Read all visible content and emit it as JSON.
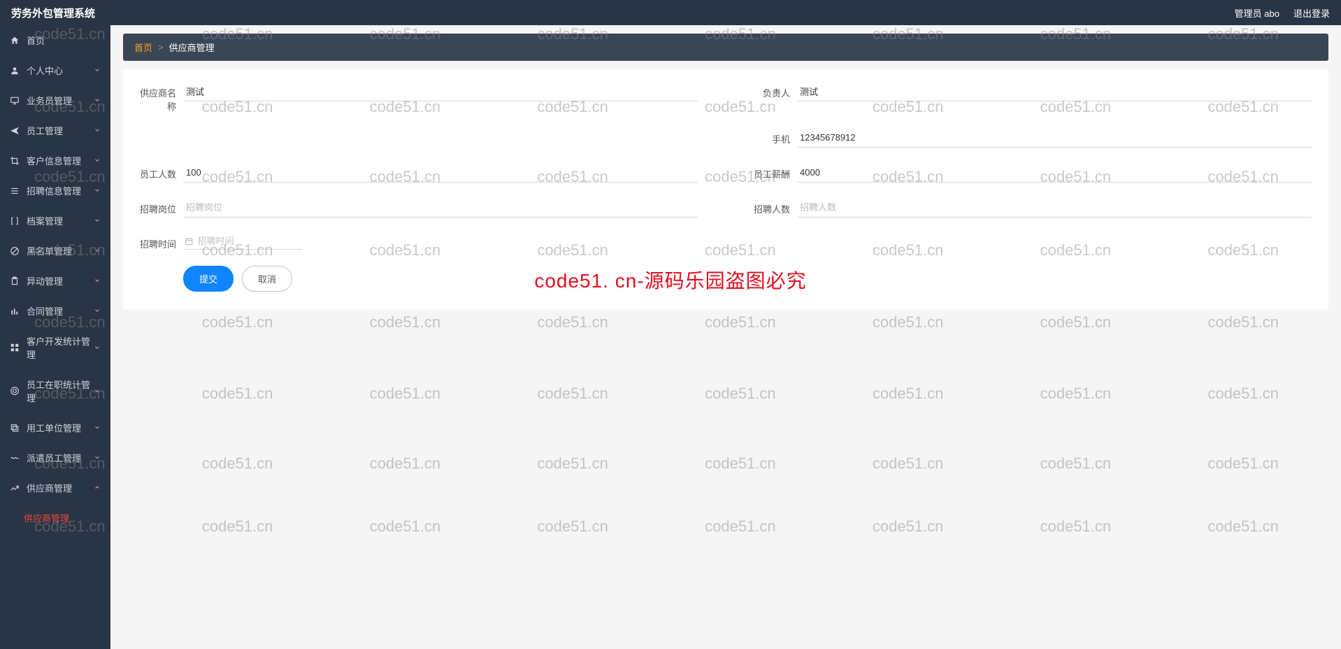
{
  "header": {
    "title": "劳务外包管理系统",
    "user_label": "管理员 abo",
    "logout_label": "退出登录"
  },
  "sidebar": {
    "items": [
      {
        "icon": "home",
        "label": "首页",
        "chevron": false
      },
      {
        "icon": "user",
        "label": "个人中心",
        "chevron": true
      },
      {
        "icon": "monitor",
        "label": "业务员管理",
        "chevron": true
      },
      {
        "icon": "send",
        "label": "员工管理",
        "chevron": true
      },
      {
        "icon": "crop",
        "label": "客户信息管理",
        "chevron": true
      },
      {
        "icon": "list",
        "label": "招聘信息管理",
        "chevron": true
      },
      {
        "icon": "bracket",
        "label": "档案管理",
        "chevron": true
      },
      {
        "icon": "slash",
        "label": "黑名单管理",
        "chevron": true
      },
      {
        "icon": "clipboard",
        "label": "异动管理",
        "chevron": true
      },
      {
        "icon": "bar",
        "label": "合同管理",
        "chevron": true
      },
      {
        "icon": "grid",
        "label": "客户开发统计管理",
        "chevron": true
      },
      {
        "icon": "target",
        "label": "员工在职统计管理",
        "chevron": true
      },
      {
        "icon": "copy",
        "label": "用工单位管理",
        "chevron": true
      },
      {
        "icon": "wave",
        "label": "派遣员工管理",
        "chevron": true
      },
      {
        "icon": "graph",
        "label": "供应商管理",
        "chevron": true,
        "expanded": true
      }
    ],
    "subitem_label": "供应商管理"
  },
  "breadcrumb": {
    "home": "首页",
    "sep": ">",
    "current": "供应商管理"
  },
  "form": {
    "supplier_name": {
      "label": "供应商名称",
      "value": "测试"
    },
    "manager": {
      "label": "负责人",
      "value": "测试"
    },
    "phone": {
      "label": "手机",
      "value": "12345678912"
    },
    "emp_count": {
      "label": "员工人数",
      "value": "100"
    },
    "emp_salary": {
      "label": "员工薪酬",
      "value": "4000"
    },
    "job_post": {
      "label": "招聘岗位",
      "placeholder": "招聘岗位",
      "value": ""
    },
    "hire_count": {
      "label": "招聘人数",
      "placeholder": "招聘人数",
      "value": ""
    },
    "hire_time": {
      "label": "招聘时间",
      "placeholder": "招聘时间",
      "value": ""
    }
  },
  "actions": {
    "submit": "提交",
    "cancel": "取消"
  },
  "watermark": {
    "small": "code51.cn",
    "main": "code51. cn-源码乐园盗图必究"
  }
}
